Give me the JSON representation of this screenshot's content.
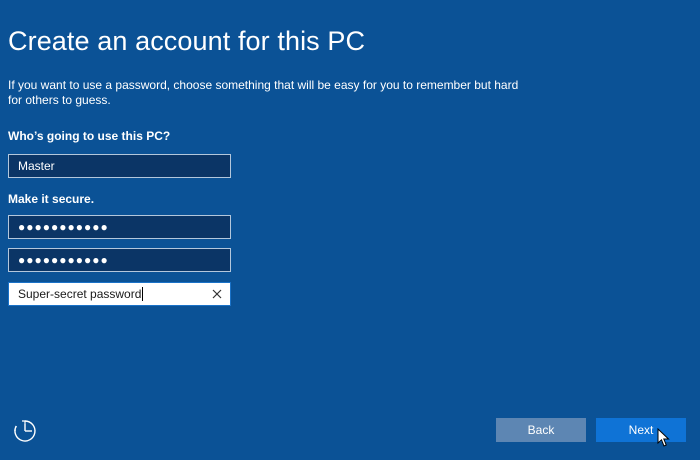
{
  "header": {
    "title": "Create an account for this PC"
  },
  "form": {
    "instruction": "If you want to use a password, choose something that will be easy for you to remember but hard for others to guess.",
    "user_label": "Who’s going to use this PC?",
    "username_value": "Master",
    "secure_label": "Make it secure.",
    "password_value": "●●●●●●●●●●●",
    "confirm_password_value": "●●●●●●●●●●●",
    "password_hint_value": "Super-secret password"
  },
  "footer": {
    "ease_of_access_icon": "ease-of-access-icon",
    "back_label": "Back",
    "next_label": "Next"
  },
  "colors": {
    "background": "#0b5296",
    "field_background": "#0b3566",
    "back_button": "#5d86b3",
    "next_button": "#0f73d6"
  }
}
